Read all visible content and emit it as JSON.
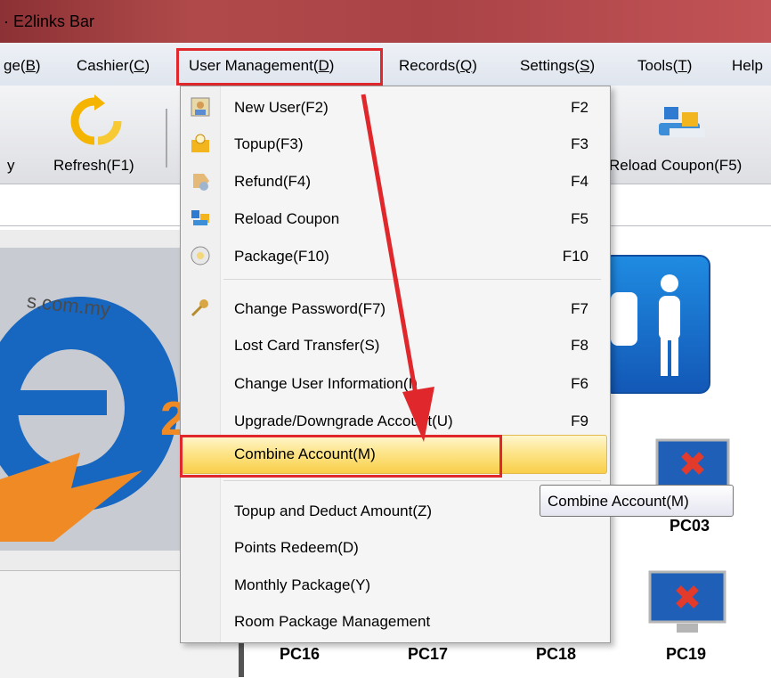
{
  "window": {
    "title": "E2links Bar"
  },
  "menubar": {
    "items": [
      {
        "label": "ge(B)"
      },
      {
        "label": "Cashier(C)"
      },
      {
        "label": "User Management(D)"
      },
      {
        "label": "Records(Q)"
      },
      {
        "label": "Settings(S)"
      },
      {
        "label": "Tools(T)"
      },
      {
        "label": "Help"
      }
    ]
  },
  "toolbar": {
    "left_fragment": "y",
    "refresh_label": "Refresh(F1)",
    "reload_coupon_label": "Reload Coupon(F5)"
  },
  "logo": {
    "url_text": "s.com.my"
  },
  "menu": {
    "items": [
      {
        "label": "New User(F2)",
        "shortcut": "F2",
        "icon": "new-user-icon"
      },
      {
        "label": "Topup(F3)",
        "shortcut": "F3",
        "icon": "topup-icon"
      },
      {
        "label": "Refund(F4)",
        "shortcut": "F4",
        "icon": "refund-icon"
      },
      {
        "label": "Reload Coupon",
        "shortcut": "F5",
        "icon": "reload-coupon-icon"
      },
      {
        "label": "Package(F10)",
        "shortcut": "F10",
        "icon": "package-icon"
      },
      {
        "label": "Change Password(F7)",
        "shortcut": "F7",
        "icon": "key-icon"
      },
      {
        "label": "Lost Card Transfer(S)",
        "shortcut": "F8"
      },
      {
        "label": "Change User Information(I)",
        "shortcut": "F6"
      },
      {
        "label": "Upgrade/Downgrade Account(U)",
        "shortcut": "F9"
      },
      {
        "label": "Combine Account(M)",
        "shortcut": ""
      },
      {
        "label": "Topup and Deduct Amount(Z)",
        "shortcut": ""
      },
      {
        "label": "Points Redeem(D)",
        "shortcut": ""
      },
      {
        "label": "Monthly Package(Y)",
        "shortcut": ""
      },
      {
        "label": "Room Package Management",
        "shortcut": ""
      }
    ]
  },
  "tooltip": {
    "text": "Combine Account(M)"
  },
  "pcs": {
    "pc03": "PC03",
    "pc16": "PC16",
    "pc17": "PC17",
    "pc18": "PC18",
    "pc19": "PC19"
  },
  "colors": {
    "highlight_box": "#e0282c",
    "titlebar": "#a94346",
    "hover": "#fde58a"
  }
}
